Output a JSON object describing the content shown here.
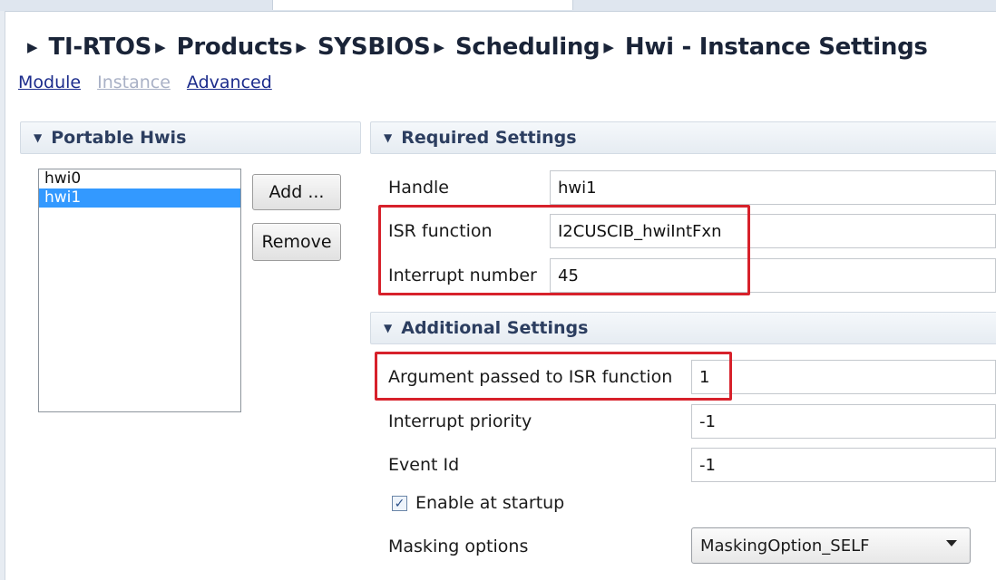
{
  "breadcrumb": [
    "TI-RTOS",
    "Products",
    "SYSBIOS",
    "Scheduling",
    "Hwi - Instance Settings"
  ],
  "page_links": {
    "module": "Module",
    "instance": "Instance",
    "advanced": "Advanced"
  },
  "portable_hwis": {
    "title": "Portable Hwis",
    "items": [
      "hwi0",
      "hwi1"
    ],
    "selected": "hwi1",
    "add_label": "Add ...",
    "remove_label": "Remove"
  },
  "required": {
    "title": "Required Settings",
    "handle_label": "Handle",
    "handle_value": "hwi1",
    "isr_label": "ISR function",
    "isr_value": "I2CUSCIB_hwiIntFxn",
    "intnum_label": "Interrupt number",
    "intnum_value": "45"
  },
  "additional": {
    "title": "Additional Settings",
    "arg_label": "Argument passed to ISR function",
    "arg_value": "1",
    "priority_label": "Interrupt priority",
    "priority_value": "-1",
    "eventid_label": "Event Id",
    "eventid_value": "-1",
    "enable_label": "Enable at startup",
    "enable_checked": true,
    "masking_label": "Masking options",
    "masking_value": "MaskingOption_SELF"
  },
  "colors": {
    "highlight": "#d7212b",
    "selection": "#3399ff",
    "link": "#1c2c8c"
  }
}
